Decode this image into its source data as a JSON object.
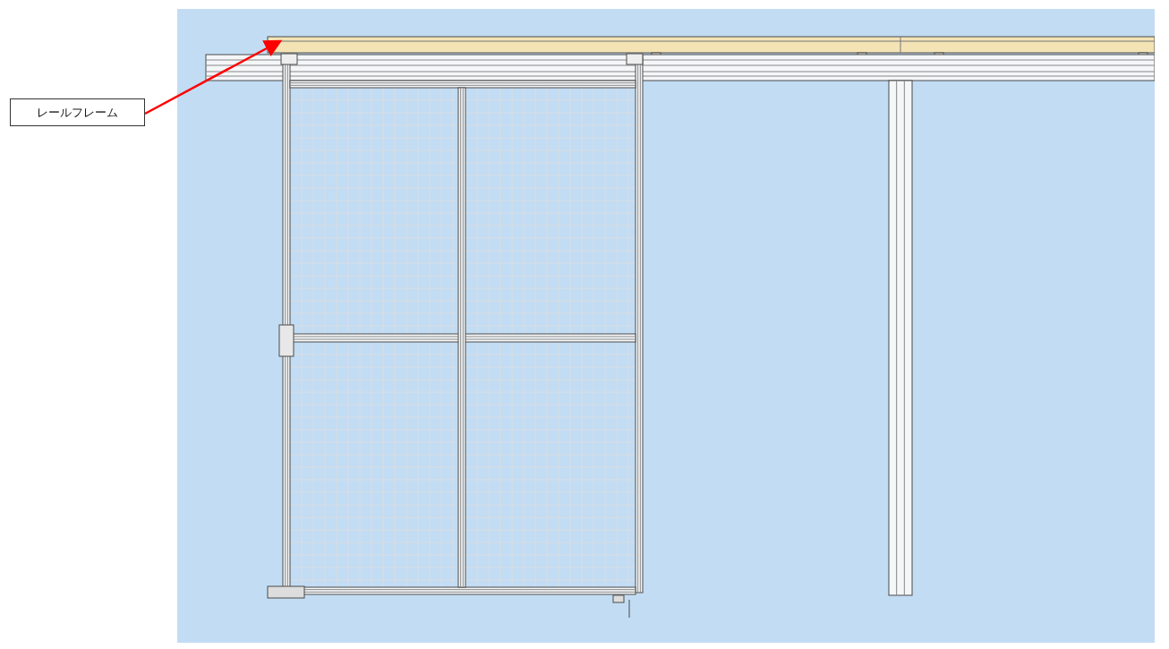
{
  "callout": {
    "label": "レールフレーム"
  }
}
